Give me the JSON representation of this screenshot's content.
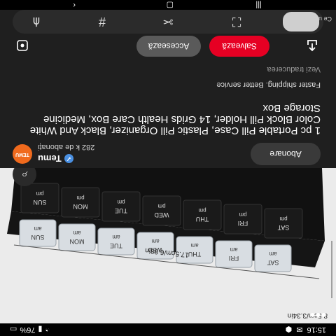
{
  "status_bar": {
    "time": "15:16",
    "battery": "76%"
  },
  "pin": {
    "width_label": "17.5cm/6.88in",
    "height_label": "8.5cm/3.34in",
    "days": [
      "SUN",
      "MON",
      "TUE",
      "WED",
      "THU",
      "FRI",
      "SAT"
    ],
    "am": "am",
    "pm": "pm"
  },
  "creator": {
    "logo": "TEMU",
    "name": "Temu",
    "subscribers": "282 k de abonați",
    "subscribe_label": "Abonare"
  },
  "title": "1 pc Portable Pill Case, Plastic Pill Organizer, Black And White Color Block Pill Holder, 14 Grids Health Care Box, Medicine Storage Box",
  "tagline": "Faster shipping. Better service",
  "translate_label": "Vezi traducerea",
  "actions": {
    "visit_label": "Accesează",
    "save_label": "Salvează"
  },
  "toolbar": {
    "preview_label": "Ce urează"
  },
  "icons": {
    "more": "more-dots-icon",
    "lens": "lens-scan-icon",
    "share": "share-icon",
    "hashtag": "hashtag-icon",
    "crop": "crop-icon",
    "scan": "scan-icon"
  }
}
